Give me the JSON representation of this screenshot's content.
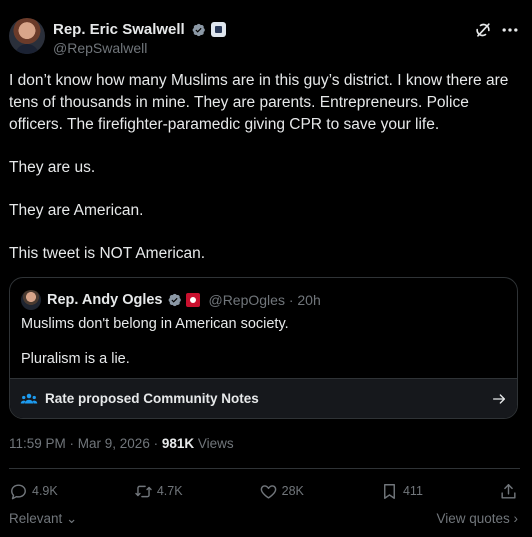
{
  "author": {
    "name": "Rep. Eric Swalwell",
    "handle": "@RepSwalwell"
  },
  "tweet": {
    "paragraphs": [
      "I don’t know how many Muslims are in this guy’s district.  I know there are tens of thousands in mine.  They are parents. Entrepreneurs.  Police officers. The firefighter-paramedic giving CPR to save your life.",
      "They are us.",
      "They are American.",
      "This tweet is NOT American."
    ]
  },
  "quote": {
    "name": "Rep. Andy Ogles",
    "handle_time": "@RepOgles · 20h",
    "lines": [
      "Muslims don't belong in American society.",
      "Pluralism is a lie."
    ],
    "community_notes": "Rate proposed Community Notes"
  },
  "meta": {
    "time": "11:59 PM · Mar 9, 2026 · ",
    "views_count": "981K",
    "views_label": " Views"
  },
  "actions": {
    "replies": "4.9K",
    "reposts": "4.7K",
    "likes": "28K",
    "bookmarks": "411"
  },
  "footer": {
    "sort": "Relevant",
    "quotes": "View quotes"
  },
  "colors": {
    "background": "#000000",
    "text": "#e7e9ea",
    "muted": "#71767b",
    "border": "#2f3336",
    "verified_blue": "#1d9bf0"
  }
}
